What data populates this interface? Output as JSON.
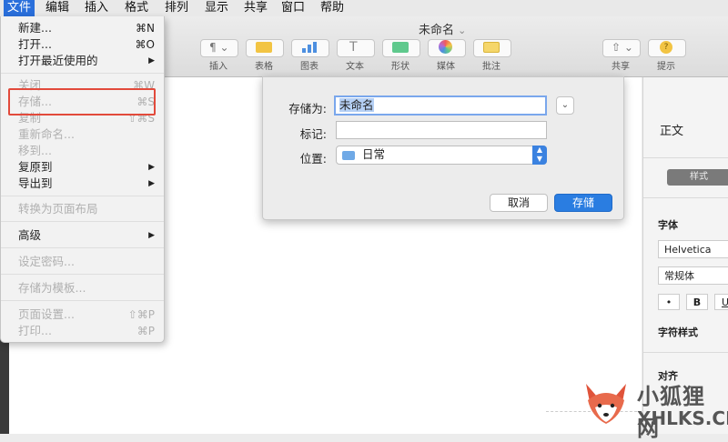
{
  "menubar": {
    "items": [
      "文件",
      "编辑",
      "插入",
      "格式",
      "排列",
      "显示",
      "共享",
      "窗口",
      "帮助"
    ],
    "active_index": 0
  },
  "window": {
    "title": "未命名",
    "title_chevron": "⌄"
  },
  "toolbar": {
    "buttons": [
      {
        "label": "插入",
        "icon": "paragraph-icon"
      },
      {
        "label": "表格",
        "icon": "table-icon"
      },
      {
        "label": "图表",
        "icon": "chart-icon"
      },
      {
        "label": "文本",
        "icon": "text-icon"
      },
      {
        "label": "形状",
        "icon": "shape-icon"
      },
      {
        "label": "媒体",
        "icon": "media-icon"
      },
      {
        "label": "批注",
        "icon": "comment-icon"
      },
      {
        "label": "共享",
        "icon": "share-icon"
      },
      {
        "label": "提示",
        "icon": "tips-icon"
      }
    ]
  },
  "file_menu": {
    "items": [
      {
        "label": "新建...",
        "shortcut": "⌘N",
        "enabled": true
      },
      {
        "label": "打开...",
        "shortcut": "⌘O",
        "enabled": true
      },
      {
        "label": "打开最近使用的",
        "shortcut": "▶",
        "enabled": true
      },
      {
        "label": "关闭",
        "shortcut": "⌘W",
        "enabled": false
      },
      {
        "label": "存储...",
        "shortcut": "⌘S",
        "enabled": false
      },
      {
        "label": "复制",
        "shortcut": "⇧⌘S",
        "enabled": false
      },
      {
        "label": "重新命名...",
        "shortcut": "",
        "enabled": false
      },
      {
        "label": "移到...",
        "shortcut": "",
        "enabled": false
      },
      {
        "label": "复原到",
        "shortcut": "▶",
        "enabled": true
      },
      {
        "label": "导出到",
        "shortcut": "▶",
        "enabled": true
      },
      {
        "label": "转换为页面布局",
        "shortcut": "",
        "enabled": false
      },
      {
        "label": "高级",
        "shortcut": "▶",
        "enabled": true
      },
      {
        "label": "设定密码...",
        "shortcut": "",
        "enabled": false
      },
      {
        "label": "存储为模板...",
        "shortcut": "",
        "enabled": false
      },
      {
        "label": "页面设置...",
        "shortcut": "⇧⌘P",
        "enabled": false
      },
      {
        "label": "打印...",
        "shortcut": "⌘P",
        "enabled": false
      }
    ]
  },
  "save_dialog": {
    "save_as_label": "存储为:",
    "save_as_value": "未命名",
    "tags_label": "标记:",
    "tags_value": "",
    "location_label": "位置:",
    "location_value": "日常",
    "cancel_label": "取消",
    "save_label": "存储"
  },
  "inspector": {
    "paragraph_style": "正文",
    "style_tab": "样式",
    "font_label": "字体",
    "font_family": "Helvetica",
    "font_style": "常规体",
    "bullet": "•",
    "bold": "B",
    "underline": "U",
    "char_style_label": "字符样式",
    "align_label": "对齐"
  },
  "watermark": {
    "cn": "小狐狸网",
    "en": "XHLKS.CN"
  },
  "colors": {
    "accent": "#2a6fdb",
    "highlight_box": "#e24a3b"
  }
}
